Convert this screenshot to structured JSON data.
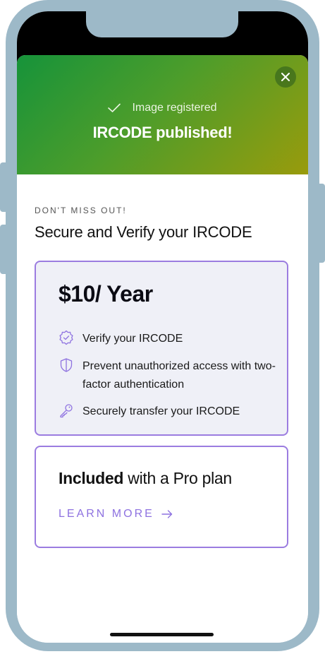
{
  "banner": {
    "status_text": "Image registered",
    "title": "IRCODE published!",
    "icons": {
      "check": "check-icon",
      "close": "close-icon"
    }
  },
  "offer": {
    "eyebrow": "DON'T MISS OUT!",
    "title": "Secure and Verify your IRCODE",
    "price": "$10/ Year",
    "features": [
      {
        "icon": "badge-check-icon",
        "text": "Verify your IRCODE"
      },
      {
        "icon": "shield-icon",
        "text": "Prevent unauthorized access with two-factor authentication"
      },
      {
        "icon": "key-icon",
        "text": "Securely transfer your IRCODE"
      }
    ]
  },
  "pro": {
    "bold_text": "Included",
    "rest_text": " with a Pro plan",
    "link_label": "LEARN MORE"
  },
  "colors": {
    "banner_gradient_start": "#16933a",
    "banner_gradient_end": "#999b0c",
    "accent_purple": "#9b7ce0",
    "price_card_bg": "#eff0f7",
    "phone_frame": "#9db9c8"
  }
}
